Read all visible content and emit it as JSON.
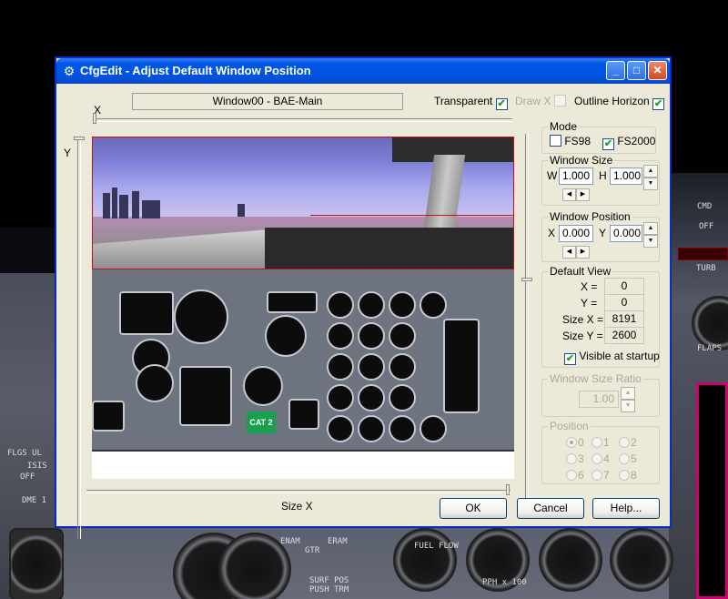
{
  "window": {
    "title": "CfgEdit - Adjust Default Window Position",
    "minimize_glyph": "_",
    "maximize_glyph": "□",
    "close_glyph": "✕"
  },
  "header": {
    "window_name": "Window00 - BAE-Main",
    "transparent_label": "Transparent",
    "transparent_checked": true,
    "drawx_label": "Draw X",
    "drawx_checked": false,
    "outline_label": "Outline Horizon",
    "outline_checked": true
  },
  "sliders": {
    "x_label": "X",
    "y_label": "Y",
    "sizex_label": "Size X"
  },
  "preview": {
    "badge": "CAT 2"
  },
  "mode": {
    "label": "Mode",
    "fs98_label": "FS98",
    "fs98_checked": false,
    "fs2000_label": "FS2000",
    "fs2000_checked": true
  },
  "window_size": {
    "label": "Window Size",
    "w_label": "W",
    "w_value": "1.000",
    "h_label": "H",
    "h_value": "1.000"
  },
  "window_position": {
    "label": "Window Position",
    "x_label": "X",
    "x_value": "0.000",
    "y_label": "Y",
    "y_value": "0.000"
  },
  "default_view": {
    "label": "Default View",
    "x_label": "X =",
    "x_value": "0",
    "y_label": "Y =",
    "y_value": "0",
    "sizex_label": "Size X =",
    "sizex_value": "8191",
    "sizey_label": "Size Y =",
    "sizey_value": "2600",
    "visible_label": "Visible at startup",
    "visible_checked": true
  },
  "ratio": {
    "label": "Window Size Ratio",
    "value": "1.00"
  },
  "position": {
    "label": "Position",
    "options": [
      "0",
      "1",
      "2",
      "3",
      "4",
      "5",
      "6",
      "7",
      "8"
    ],
    "selected": "0"
  },
  "buttons": {
    "ok": "OK",
    "cancel": "Cancel",
    "help": "Help..."
  },
  "background": {
    "labels": [
      "DME 1",
      "FLAPS",
      "TURB",
      "CMD",
      "OFF",
      "GTR",
      "ENAM",
      "ERAM",
      "PUSH TRM",
      "SURF POS",
      "FUEL FLOW",
      "PPH x 100",
      "FLGS UL",
      "ISIS",
      "OFF"
    ]
  },
  "colors": {
    "title_blue": "#0054e3",
    "dialog_face": "#ece9d8",
    "outline_red": "#c8101c",
    "badge_green": "#18a04e"
  }
}
